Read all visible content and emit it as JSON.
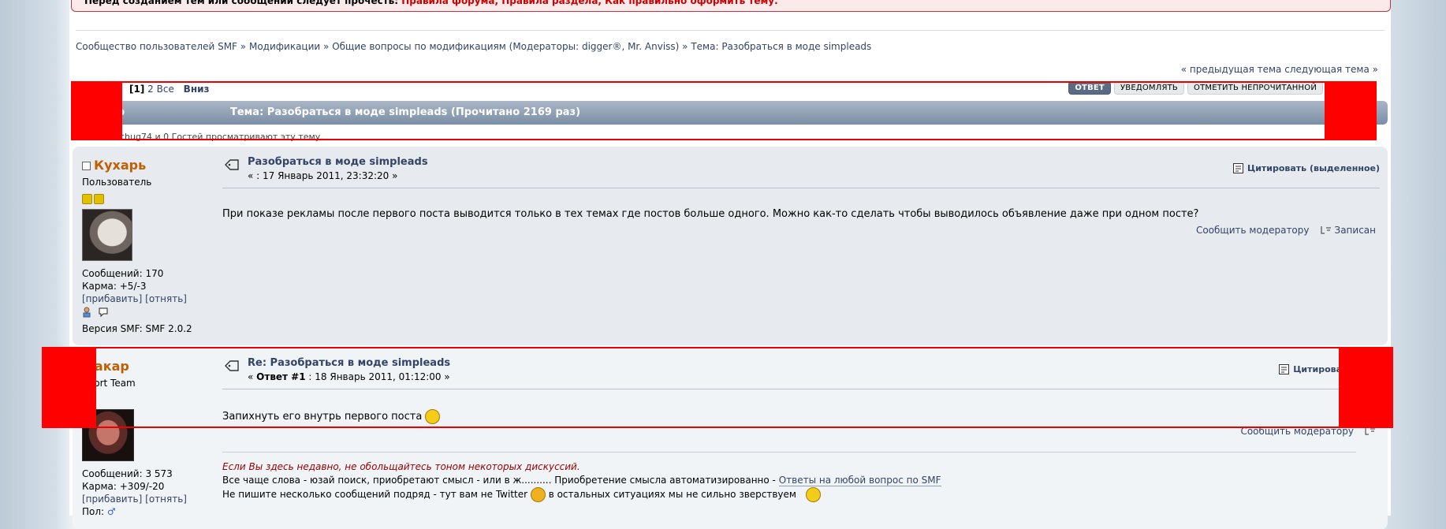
{
  "notice": {
    "lead": "Перед созданием тем или сообщений следует прочесть:",
    "rules": "Правила форума, Правила раздела, Как правильно оформить тему."
  },
  "breadcrumb": [
    "Сообщество пользователей SMF",
    "Модификации",
    "Общие вопросы по модификациям (Модераторы: digger®, Mr. Anviss)",
    "Тема: Разобраться в моде simpleads"
  ],
  "breadcrumb_sep": "»",
  "nav": {
    "prev": "« предыдущая тема",
    "next": "следующая тема »"
  },
  "pages": {
    "cur": "[1]",
    "p2": "2",
    "all": "Все",
    "down": "Вниз"
  },
  "buttons": {
    "reply": "ОТВЕТ",
    "notify": "УВЕДОМЛЯТЬ",
    "mark_unread": "ОТМЕТИТЬ НЕПРОЧИТАННОЙ"
  },
  "catbar": {
    "author": "ор",
    "topic": "Тема: Разобраться в моде simpleads  (Прочитано 2169 раз)"
  },
  "viewing": "chug74 и 0 Гостей просматривают эту тему.",
  "posts": [
    {
      "name": "Кухарь",
      "title": "Пользователь",
      "subject": "Разобраться в моде simpleads",
      "date": "« : 17 Январь 2011, 23:32:20 »",
      "body": "При показе рекламы после первого поста выводится только в тех темах где постов больше одного. Можно как-то сделать чтобы выводилось объявление даже при одном посте?",
      "stats": {
        "posts": "Сообщений: 170",
        "karma": "Карма: +5/-3",
        "applaud": "[прибавить]",
        "smite": "[отнять]",
        "smf_version": "Версия SMF: SMF 2.0.2"
      },
      "quote": "Цитировать (выделенное)",
      "report": "Сообщить модератору",
      "logged": "Записан"
    },
    {
      "name": "Макар",
      "title": "pport Team",
      "subject": "Re: Разобраться в моде simpleads",
      "date_label": "Ответ #1",
      "date": " : 18 Январь 2011, 01:12:00 »",
      "date_open": "« ",
      "body": "Запихнуть его внутрь первого поста",
      "stats": {
        "posts": "Сообщений: 3 573",
        "karma": "Карма: +309/-20",
        "applaud": "[прибавить]",
        "smite": "[отнять]",
        "gender": "Пол:"
      },
      "quote": "Цитировать (выд",
      "report": "Сообщить модератору",
      "signature": {
        "line1": "Если Вы здесь недавно, не обольщайтесь тоном некоторых дискуссий.",
        "line2_a": "Все чаще слова - юзай поиск, приобретают смысл - или в ж..........  Приобретение смысла автоматизированно - ",
        "line2_link": "Ответы на любой вопрос по SMF",
        "line3_a": "Не пишите несколько сообщений подряд - тут вам не Twitter",
        "line3_b": "в остальных ситуациях мы не сильно зверствуем"
      }
    }
  ],
  "colors": {
    "accent": "#334466",
    "poster_name": "#c06002",
    "redaction": "#ff0000"
  }
}
